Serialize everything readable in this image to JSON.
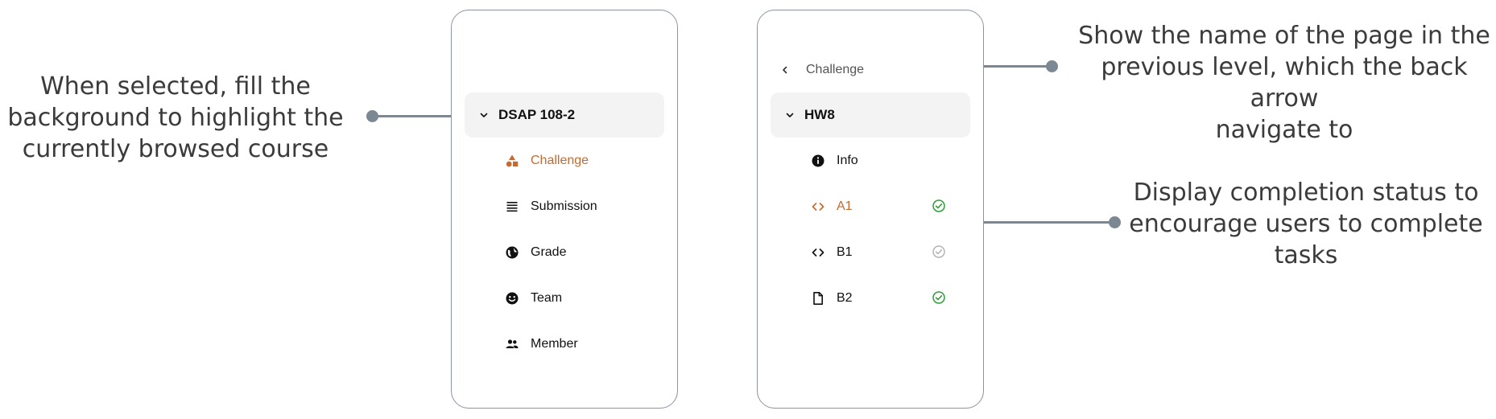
{
  "annotations": {
    "left": [
      "When selected, fill the",
      "background to highlight the",
      "currently browsed course"
    ],
    "top_right": [
      "Show the name of the page in the",
      "previous level, which the back arrow",
      "navigate to"
    ],
    "mid_right": [
      "Display completion status to",
      "encourage users to complete",
      "tasks"
    ]
  },
  "panel_left": {
    "course": "DSAP 108-2",
    "items": [
      {
        "label": "Challenge",
        "icon": "shapes-icon",
        "active": true
      },
      {
        "label": "Submission",
        "icon": "list-icon",
        "active": false
      },
      {
        "label": "Grade",
        "icon": "globe-icon",
        "active": false
      },
      {
        "label": "Team",
        "icon": "smiley-icon",
        "active": false
      },
      {
        "label": "Member",
        "icon": "people-icon",
        "active": false
      }
    ]
  },
  "panel_right": {
    "back_label": "Challenge",
    "group": "HW8",
    "items": [
      {
        "label": "Info",
        "icon": "info-icon",
        "status": null
      },
      {
        "label": "A1",
        "icon": "code-icon",
        "status": "complete",
        "active": true
      },
      {
        "label": "B1",
        "icon": "code-icon",
        "status": "incomplete"
      },
      {
        "label": "B2",
        "icon": "file-icon",
        "status": "complete"
      }
    ]
  },
  "colors": {
    "accent": "#c46a32",
    "highlight_bg": "#f3f3f3",
    "complete": "#2e9d3a",
    "incomplete": "#b5b5b5",
    "leader": "#7b8792",
    "panel_border": "#8c93a1"
  }
}
